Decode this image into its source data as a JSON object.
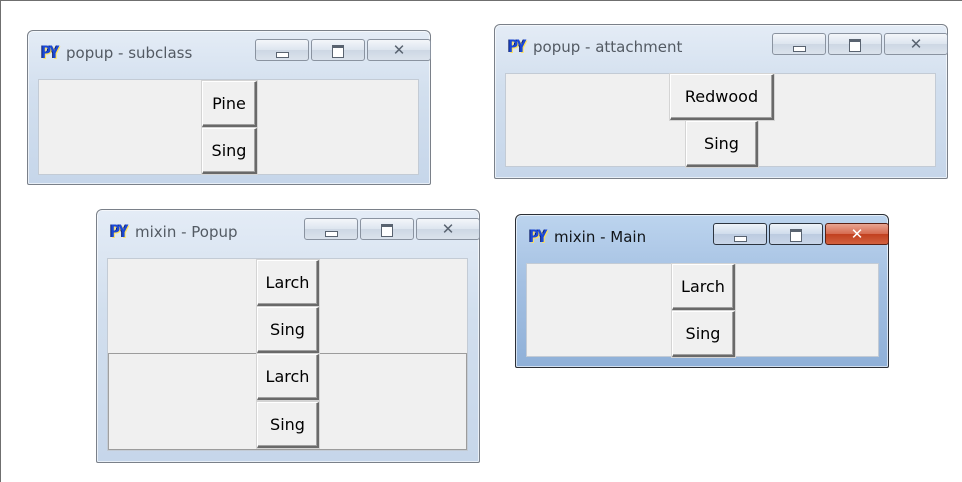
{
  "windows": [
    {
      "title": "popup - subclass",
      "icon": "python-icon",
      "controls": [
        "minimize",
        "maximize",
        "close"
      ],
      "buttons": [
        {
          "label": "Pine"
        },
        {
          "label": "Sing"
        }
      ]
    },
    {
      "title": "popup - attachment",
      "icon": "python-icon",
      "controls": [
        "minimize",
        "maximize",
        "close"
      ],
      "buttons": [
        {
          "label": "Redwood"
        },
        {
          "label": "Sing"
        }
      ]
    },
    {
      "title": "mixin - Popup",
      "icon": "python-icon",
      "controls": [
        "minimize",
        "maximize",
        "close"
      ],
      "buttons": [
        {
          "label": "Larch"
        },
        {
          "label": "Sing"
        },
        {
          "label": "Larch"
        },
        {
          "label": "Sing"
        }
      ]
    },
    {
      "title": "mixin - Main",
      "icon": "python-icon",
      "active": true,
      "controls": [
        "minimize",
        "maximize",
        "close"
      ],
      "buttons": [
        {
          "label": "Larch"
        },
        {
          "label": "Sing"
        }
      ]
    }
  ],
  "icon_glyph": "PY",
  "colors": {
    "client_bg": "#f0f0f0",
    "inactive_title_text": "#535a63",
    "active_close_button": "#c1401f",
    "python_icon": "#1b48d6"
  }
}
